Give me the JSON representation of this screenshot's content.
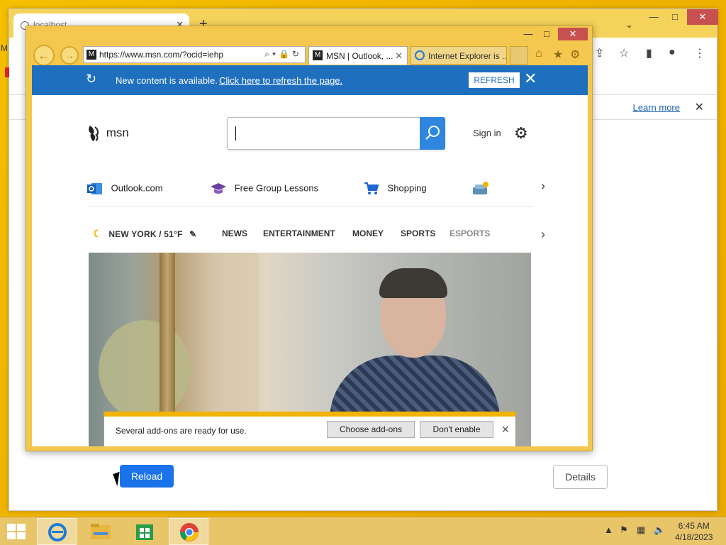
{
  "chrome": {
    "tab_title": "localhost",
    "learn_more": "Learn more",
    "reload_label": "Reload",
    "details_label": "Details",
    "left_strip_text": "M"
  },
  "ie": {
    "address": "https://www.msn.com/?ocid=iehp",
    "tabs": [
      {
        "label": "MSN | Outlook, ..."
      },
      {
        "label": "Internet Explorer is ..."
      }
    ],
    "notification": {
      "message": "New content is available.",
      "link": "Click here to refresh the page.",
      "refresh": "REFRESH"
    }
  },
  "msn": {
    "logo_text": "msn",
    "search_placeholder": "",
    "sign_in": "Sign in",
    "quick_links": [
      {
        "label": "Outlook.com",
        "icon": "outlook-icon"
      },
      {
        "label": "Free Group Lessons",
        "icon": "graduation-cap-icon"
      },
      {
        "label": "Shopping",
        "icon": "shopping-cart-icon"
      },
      {
        "label": "",
        "icon": "car-icon"
      }
    ],
    "weather": "NEW YORK / 51°F",
    "nav": [
      "NEWS",
      "ENTERTAINMENT",
      "MONEY",
      "SPORTS",
      "ESPORTS"
    ]
  },
  "addons": {
    "message": "Several add-ons are ready for use.",
    "choose": "Choose add-ons",
    "dont": "Don't enable"
  },
  "taskbar": {
    "time": "6:45 AM",
    "date": "4/18/2023"
  },
  "colors": {
    "desktop": "#f5c000",
    "ie_frame": "#f4c84e",
    "notify_bar": "#1f6fbf",
    "chrome_button": "#1a73e8"
  }
}
